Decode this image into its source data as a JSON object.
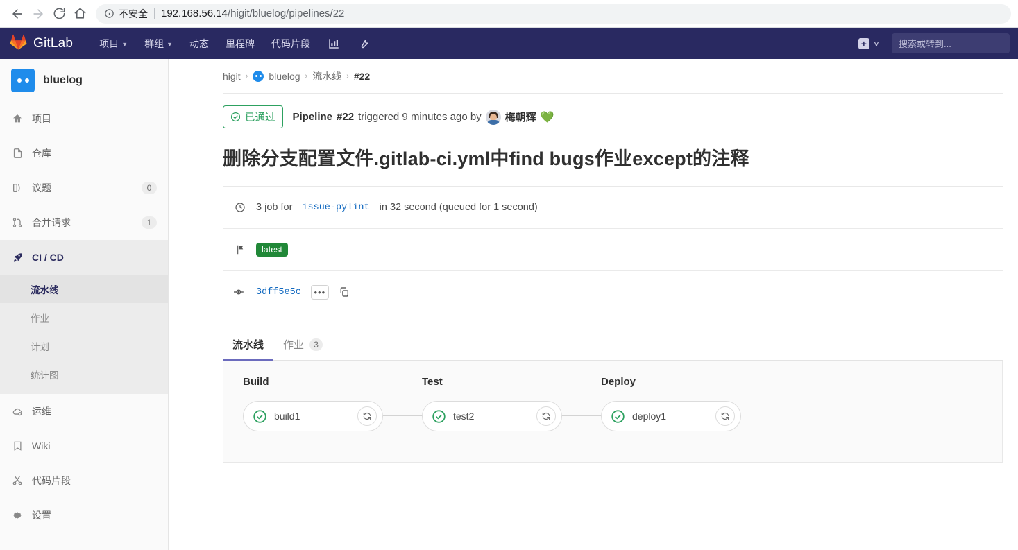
{
  "browser": {
    "back_icon": "arrow-left-icon",
    "forward_icon": "arrow-right-icon",
    "reload_icon": "reload-icon",
    "home_icon": "home-icon",
    "security_label": "不安全",
    "url_host": "192.168.56.14",
    "url_path": "/higit/bluelog/pipelines/22"
  },
  "navbar": {
    "brand": "GitLab",
    "items": [
      {
        "label": "项目",
        "has_caret": true
      },
      {
        "label": "群组",
        "has_caret": true
      },
      {
        "label": "动态",
        "has_caret": false
      },
      {
        "label": "里程碑",
        "has_caret": false
      },
      {
        "label": "代码片段",
        "has_caret": false
      }
    ],
    "icons": [
      "analytics-chart-icon",
      "wrench-admin-icon"
    ],
    "plus_icon": "plus-icon",
    "plus_caret_icon": "chevron-down-icon",
    "search_placeholder": "搜索或转到..."
  },
  "sidebar": {
    "project_name": "bluelog",
    "project_avatar": "project-avatar",
    "items": [
      {
        "label": "项目",
        "icon": "home-icon",
        "count": ""
      },
      {
        "label": "仓库",
        "icon": "file-icon",
        "count": ""
      },
      {
        "label": "议题",
        "icon": "issues-icon",
        "count": "0"
      },
      {
        "label": "合并请求",
        "icon": "merge-request-icon",
        "count": "1"
      },
      {
        "label": "CI / CD",
        "icon": "rocket-icon",
        "count": "",
        "active": true
      },
      {
        "label": "运维",
        "icon": "cloud-gear-icon",
        "count": ""
      },
      {
        "label": "Wiki",
        "icon": "book-icon",
        "count": ""
      },
      {
        "label": "代码片段",
        "icon": "scissors-icon",
        "count": ""
      },
      {
        "label": "设置",
        "icon": "gear-icon",
        "count": ""
      }
    ],
    "sub_items": [
      {
        "label": "流水线",
        "active": true
      },
      {
        "label": "作业",
        "active": false
      },
      {
        "label": "计划",
        "active": false
      },
      {
        "label": "统计图",
        "active": false
      }
    ]
  },
  "breadcrumb": {
    "group": "higit",
    "project": "bluelog",
    "section": "流水线",
    "current": "#22",
    "separator": "›"
  },
  "pipeline": {
    "status_label": "已通过",
    "status_icon": "check-circle-icon",
    "status_color": "#2da160",
    "headline_prefix": "Pipeline",
    "headline_id": "#22",
    "headline_middle": "triggered 9 minutes ago by",
    "user_name": "梅朝辉",
    "user_emoji": "💚",
    "title": "删除分支配置文件.gitlab-ci.yml中find bugs作业except的注释",
    "jobs_summary_count": "3 job for",
    "jobs_summary_ref": "issue-pylint",
    "jobs_summary_duration": "in 32 second (queued for 1 second)",
    "summary_icon": "clock-icon",
    "tag_icon": "flag-icon",
    "tag_label": "latest",
    "commit_icon": "commit-icon",
    "commit_sha": "3dff5e5c",
    "commit_more_label": "•••",
    "copy_icon": "copy-icon"
  },
  "tabs": [
    {
      "label": "流水线",
      "count": "",
      "active": true
    },
    {
      "label": "作业",
      "count": "3",
      "active": false
    }
  ],
  "graph": {
    "stages": [
      {
        "name": "Build",
        "jobs": [
          {
            "name": "build1",
            "status": "success",
            "status_icon": "check-circle-icon",
            "retry_icon": "retry-icon"
          }
        ]
      },
      {
        "name": "Test",
        "jobs": [
          {
            "name": "test2",
            "status": "success",
            "status_icon": "check-circle-icon",
            "retry_icon": "retry-icon"
          }
        ]
      },
      {
        "name": "Deploy",
        "jobs": [
          {
            "name": "deploy1",
            "status": "success",
            "status_icon": "check-circle-icon",
            "retry_icon": "retry-icon"
          }
        ]
      }
    ]
  }
}
